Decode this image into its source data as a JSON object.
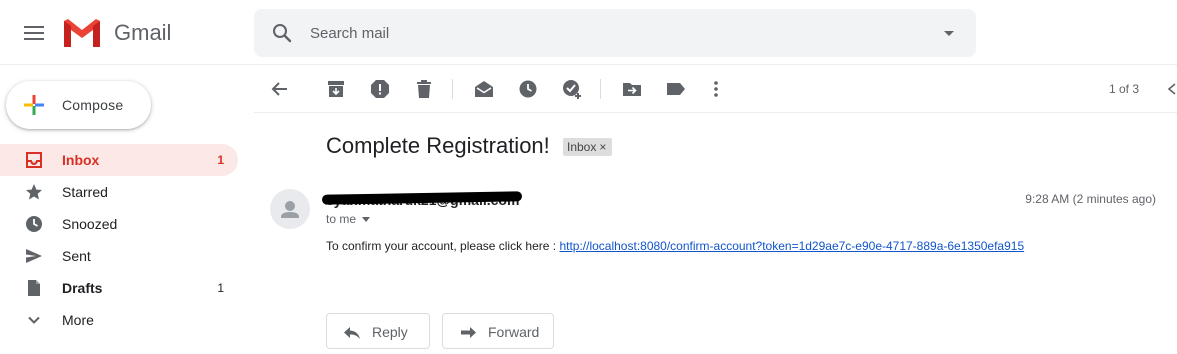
{
  "header": {
    "brand": "Gmail",
    "search_placeholder": "Search mail"
  },
  "sidebar": {
    "compose_label": "Compose",
    "items": [
      {
        "label": "Inbox",
        "count": "1",
        "icon": "inbox-icon"
      },
      {
        "label": "Starred",
        "count": "",
        "icon": "star-icon"
      },
      {
        "label": "Snoozed",
        "count": "",
        "icon": "clock-icon"
      },
      {
        "label": "Sent",
        "count": "",
        "icon": "send-icon"
      },
      {
        "label": "Drafts",
        "count": "1",
        "icon": "draft-icon"
      },
      {
        "label": "More",
        "count": "",
        "icon": "chevron-down-icon"
      }
    ]
  },
  "toolbar": {
    "pager": "1 of 3"
  },
  "message": {
    "subject": "Complete Registration!",
    "label": "Inbox",
    "label_close": "×",
    "sender": "cyanmatharuk21@gmail.com",
    "to_line": "to me",
    "time": "9:28 AM (2 minutes ago)",
    "body_text": "To confirm your account, please click here : ",
    "link": "http://localhost:8080/confirm-account?token=1d29ae7c-e90e-4717-889a-6e1350efa915"
  },
  "actions": {
    "reply": "Reply",
    "forward": "Forward"
  },
  "colors": {
    "active_red": "#d93025",
    "active_bg": "#fce8e6",
    "link_blue": "#1155cc",
    "icon_gray": "#5f6368"
  }
}
